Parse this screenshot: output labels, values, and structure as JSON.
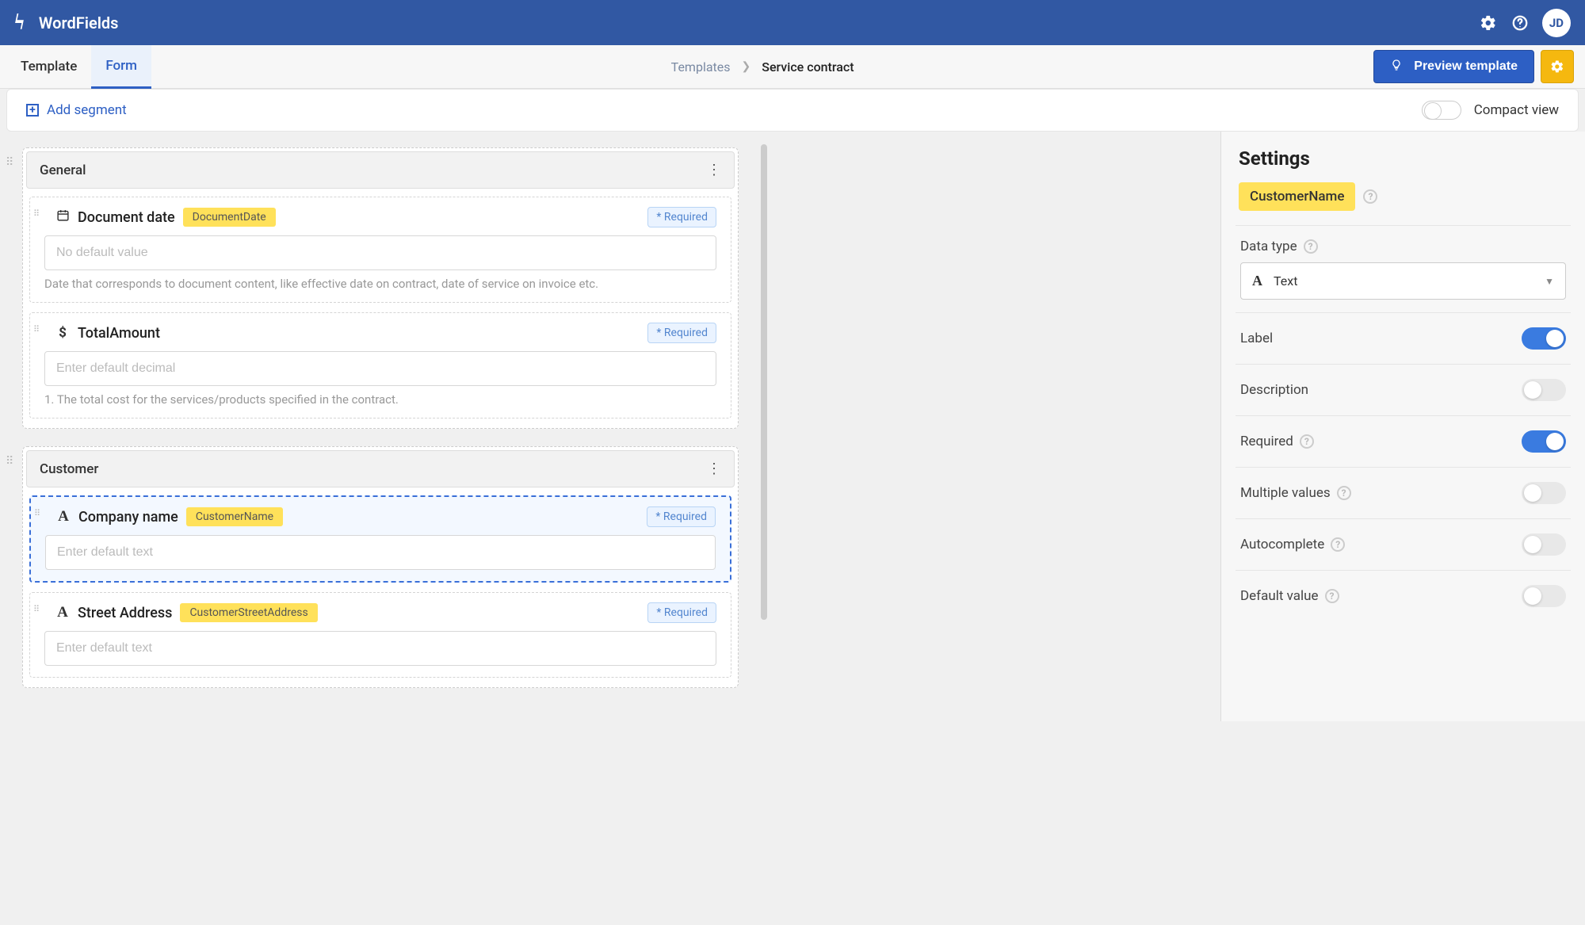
{
  "header": {
    "app_name": "WordFields",
    "settings_icon": "gear",
    "help_icon": "question",
    "avatar_initials": "JD"
  },
  "toolbar": {
    "tab_template": "Template",
    "tab_form": "Form",
    "breadcrumb_root": "Templates",
    "breadcrumb_current": "Service contract",
    "preview_label": "Preview template"
  },
  "subtoolbar": {
    "add_segment": "Add segment",
    "compact_view": "Compact view"
  },
  "segments": [
    {
      "title": "General",
      "fields": [
        {
          "icon": "calendar",
          "label": "Document date",
          "tag": "DocumentDate",
          "required": "* Required",
          "placeholder": "No default value",
          "help": "Date that corresponds to document content, like effective date on contract, date of service on invoice etc."
        },
        {
          "icon": "dollar",
          "label": "TotalAmount",
          "tag": "",
          "required": "* Required",
          "placeholder": "Enter default decimal",
          "help": "1. The total cost for the services/products specified in the contract."
        }
      ]
    },
    {
      "title": "Customer",
      "fields": [
        {
          "icon": "text",
          "label": "Company name",
          "tag": "CustomerName",
          "required": "* Required",
          "placeholder": "Enter default text",
          "help": "",
          "selected": true
        },
        {
          "icon": "text",
          "label": "Street Address",
          "tag": "CustomerStreetAddress",
          "required": "* Required",
          "placeholder": "Enter default text",
          "help": ""
        }
      ]
    }
  ],
  "sidebar": {
    "title": "Settings",
    "selected_tag": "CustomerName",
    "datatype_label": "Data type",
    "datatype_value": "Text",
    "toggles": {
      "label": "Label",
      "description": "Description",
      "required": "Required",
      "multiple": "Multiple values",
      "autocomplete": "Autocomplete",
      "default_value": "Default value"
    }
  }
}
